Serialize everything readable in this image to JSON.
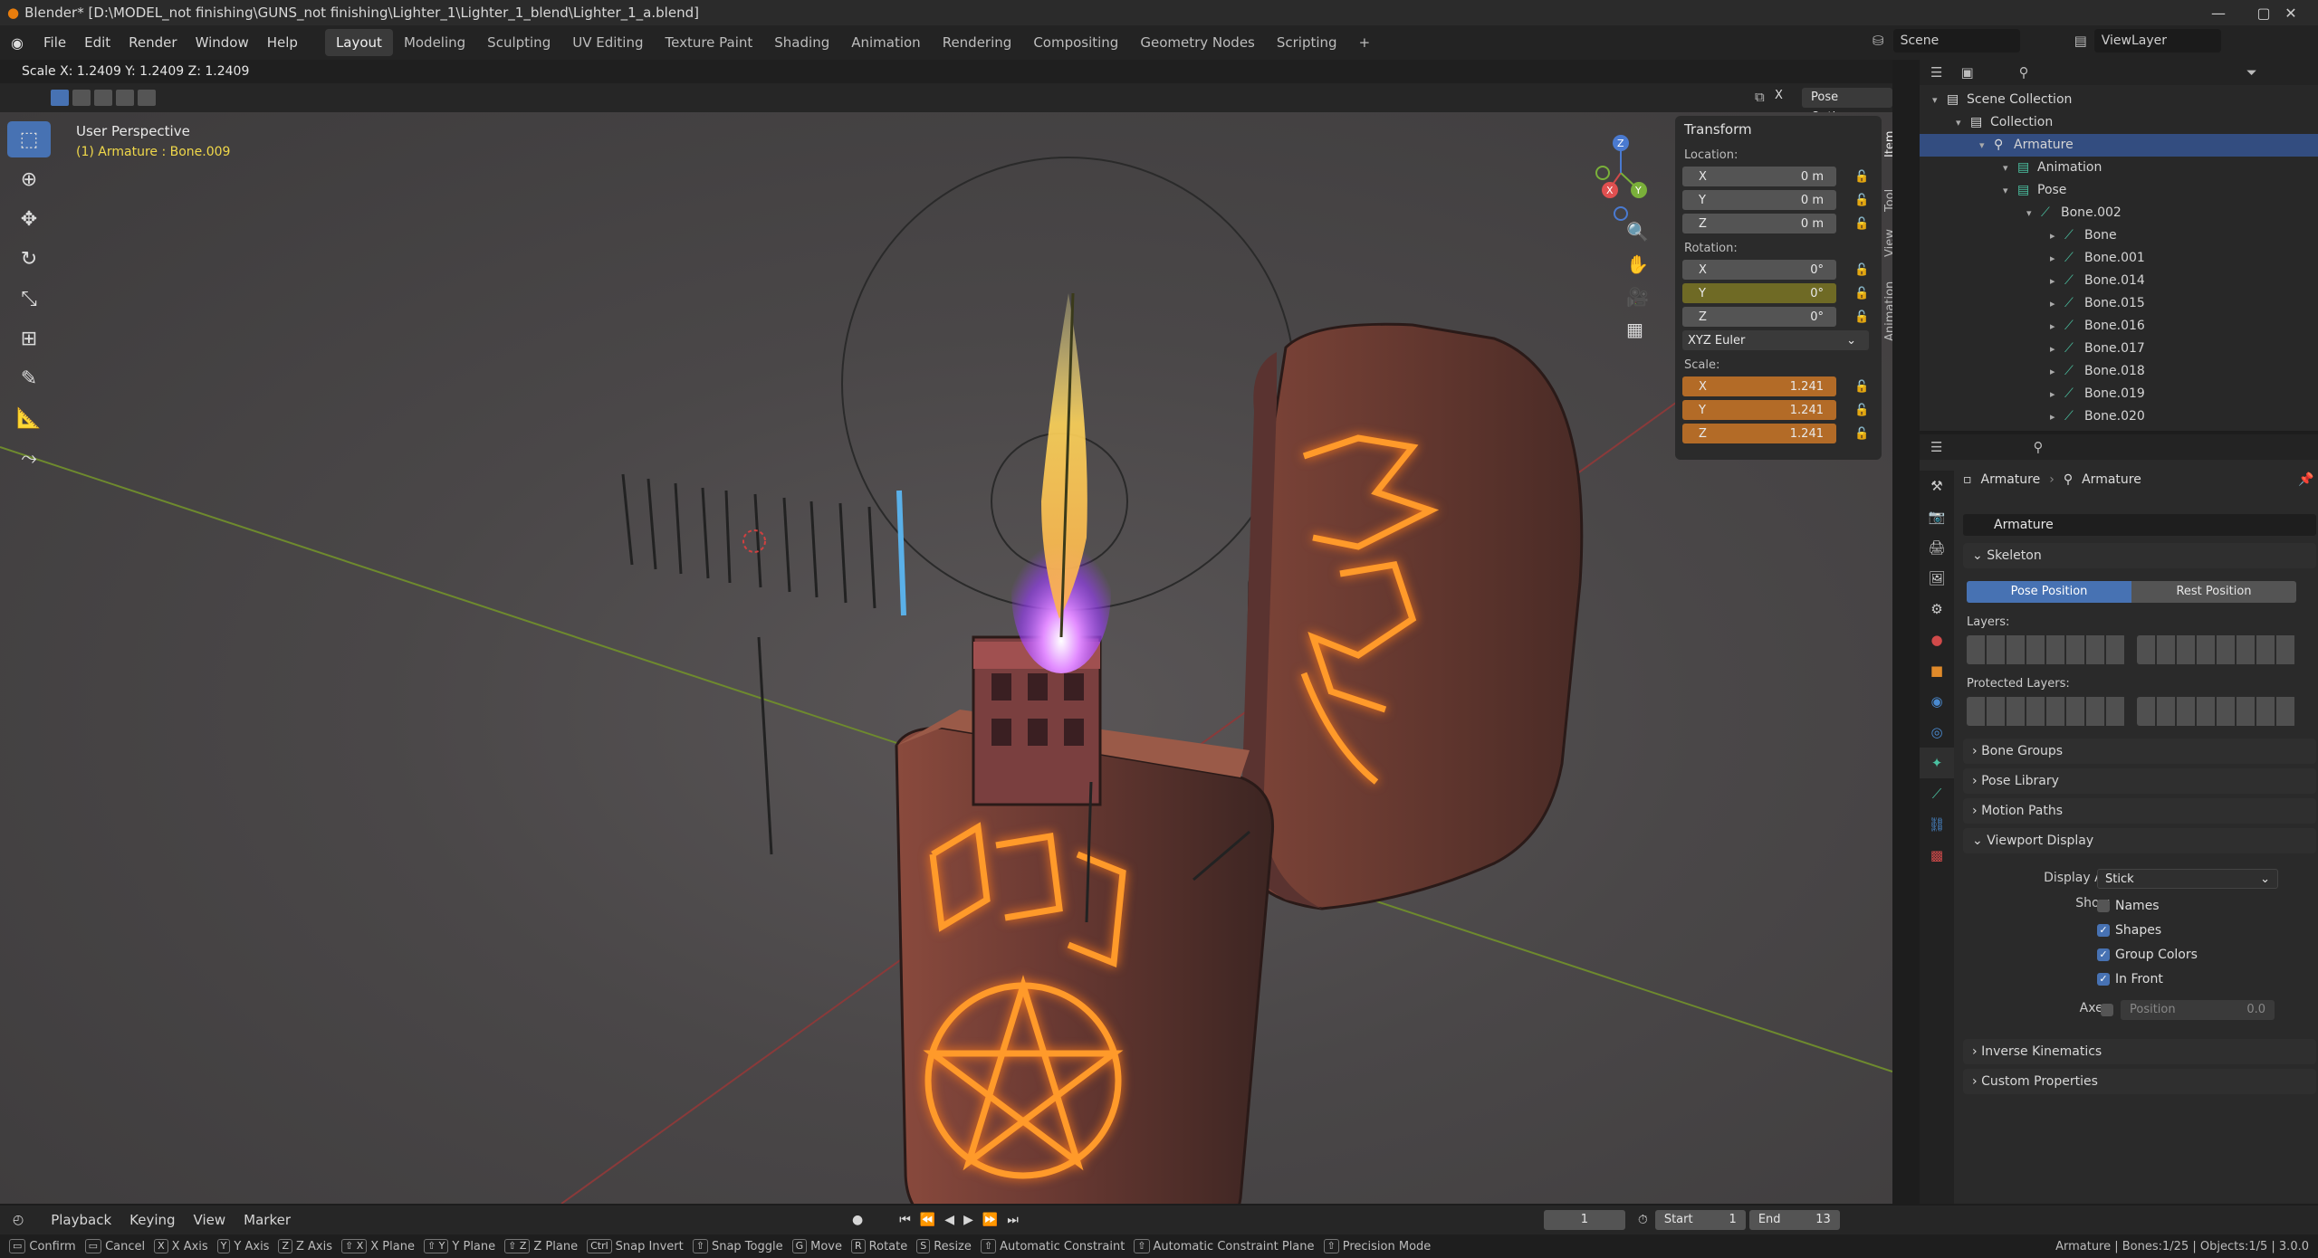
{
  "window": {
    "title": "Blender* [D:\\MODEL_not finishing\\GUNS_not finishing\\Lighter_1\\Lighter_1_blend\\Lighter_1_a.blend]",
    "minimize": "—",
    "maximize": "▢",
    "close": "✕"
  },
  "menu": [
    "File",
    "Edit",
    "Render",
    "Window",
    "Help"
  ],
  "workspaces": [
    "Layout",
    "Modeling",
    "Sculpting",
    "UV Editing",
    "Texture Paint",
    "Shading",
    "Animation",
    "Rendering",
    "Compositing",
    "Geometry Nodes",
    "Scripting",
    "+"
  ],
  "scene": {
    "label": "Scene",
    "viewlayer": "ViewLayer"
  },
  "header": {
    "scale_readout": "Scale X: 1.2409   Y: 1.2409   Z: 1.2409",
    "pose_options": "Pose Options"
  },
  "viewport": {
    "perspective": "User Perspective",
    "active": "(1) Armature : Bone.009"
  },
  "npanel": {
    "title": "Transform",
    "location_label": "Location:",
    "location": [
      {
        "axis": "X",
        "value": "0 m"
      },
      {
        "axis": "Y",
        "value": "0 m"
      },
      {
        "axis": "Z",
        "value": "0 m"
      }
    ],
    "rotation_label": "Rotation:",
    "rotation": [
      {
        "axis": "X",
        "value": "0°"
      },
      {
        "axis": "Y",
        "value": "0°"
      },
      {
        "axis": "Z",
        "value": "0°"
      }
    ],
    "rotation_mode": "XYZ Euler",
    "scale_label": "Scale:",
    "scale": [
      {
        "axis": "X",
        "value": "1.241"
      },
      {
        "axis": "Y",
        "value": "1.241"
      },
      {
        "axis": "Z",
        "value": "1.241"
      }
    ],
    "tabs": [
      "Item",
      "Tool",
      "View",
      "Animation"
    ]
  },
  "outliner": {
    "rows": [
      {
        "label": "Scene Collection",
        "indent": 0
      },
      {
        "label": "Collection",
        "indent": 1
      },
      {
        "label": "Armature",
        "indent": 2,
        "selected": true
      },
      {
        "label": "Animation",
        "indent": 3
      },
      {
        "label": "Pose",
        "indent": 3
      },
      {
        "label": "Bone.002",
        "indent": 4
      },
      {
        "label": "Bone",
        "indent": 5
      },
      {
        "label": "Bone.001",
        "indent": 5
      },
      {
        "label": "Bone.014",
        "indent": 5
      },
      {
        "label": "Bone.015",
        "indent": 5
      },
      {
        "label": "Bone.016",
        "indent": 5
      },
      {
        "label": "Bone.017",
        "indent": 5
      },
      {
        "label": "Bone.018",
        "indent": 5
      },
      {
        "label": "Bone.019",
        "indent": 5
      },
      {
        "label": "Bone.020",
        "indent": 5
      }
    ]
  },
  "properties": {
    "breadcrumb": [
      "Armature",
      "Armature"
    ],
    "datablock": "Armature",
    "skeleton": "Skeleton",
    "pose_position": "Pose Position",
    "rest_position": "Rest Position",
    "layers": "Layers:",
    "protected_layers": "Protected Layers:",
    "sections": [
      "Bone Groups",
      "Pose Library",
      "Motion Paths"
    ],
    "viewport_display": "Viewport Display",
    "display_as_label": "Display As",
    "display_as": "Stick",
    "show_label": "Show",
    "show": [
      {
        "label": "Names",
        "checked": false
      },
      {
        "label": "Shapes",
        "checked": true
      },
      {
        "label": "Group Colors",
        "checked": true
      },
      {
        "label": "In Front",
        "checked": true
      }
    ],
    "axes_label": "Axes",
    "axes_position": "Position",
    "axes_value": "0.0",
    "more_sections": [
      "Inverse Kinematics",
      "Custom Properties"
    ]
  },
  "timeline": {
    "playback": "Playback",
    "keying": "Keying",
    "view": "View",
    "marker": "Marker",
    "frame": "1",
    "start_label": "Start",
    "start": "1",
    "end_label": "End",
    "end": "13"
  },
  "statusbar": {
    "hints": [
      {
        "key": "",
        "label": "Confirm"
      },
      {
        "key": "",
        "label": "Cancel"
      },
      {
        "key": "X",
        "label": "X Axis"
      },
      {
        "key": "Y",
        "label": "Y Axis"
      },
      {
        "key": "Z",
        "label": "Z Axis"
      },
      {
        "key": "⇧ X",
        "label": "X Plane"
      },
      {
        "key": "⇧ Y",
        "label": "Y Plane"
      },
      {
        "key": "⇧ Z",
        "label": "Z Plane"
      },
      {
        "key": "Ctrl",
        "label": "Snap Invert"
      },
      {
        "key": "⇧",
        "label": "Snap Toggle"
      },
      {
        "key": "G",
        "label": "Move"
      },
      {
        "key": "R",
        "label": "Rotate"
      },
      {
        "key": "S",
        "label": "Resize"
      },
      {
        "key": "⇧",
        "label": "Automatic Constraint"
      },
      {
        "key": "⇧",
        "label": "Automatic Constraint Plane"
      },
      {
        "key": "⇧",
        "label": "Precision Mode"
      }
    ],
    "info": "Armature | Bones:1/25 | Objects:1/5 | 3.0.0"
  }
}
